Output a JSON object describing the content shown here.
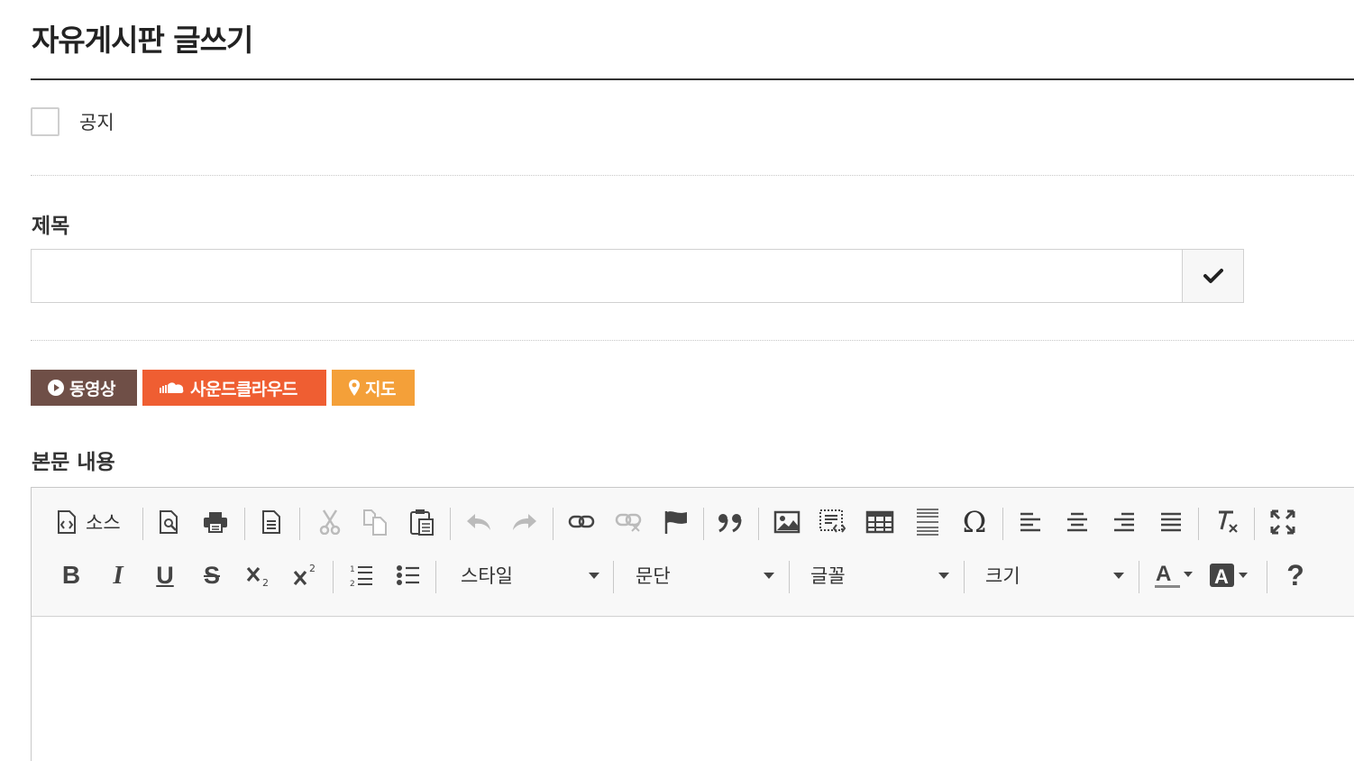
{
  "page": {
    "title": "자유게시판 글쓰기"
  },
  "notice": {
    "label": "공지",
    "checked": false
  },
  "subject": {
    "label": "제목",
    "value": "",
    "placeholder": ""
  },
  "media_buttons": {
    "video": {
      "label": "동영상",
      "icon": "play-circle-icon",
      "color": "#6f4f47"
    },
    "soundcloud": {
      "label": "사운드클라우드",
      "icon": "soundcloud-icon",
      "color": "#ef5e32"
    },
    "map": {
      "label": "지도",
      "icon": "map-marker-icon",
      "color": "#f4a039"
    }
  },
  "body": {
    "label": "본문 내용",
    "content": ""
  },
  "editor_toolbar": {
    "source_label": "소스",
    "style_combo": "스타일",
    "paragraph_combo": "문단",
    "font_combo": "글꼴",
    "size_combo": "크기",
    "row1_icons": [
      "source-icon",
      "preview-icon",
      "print-icon",
      "templates-icon",
      "cut-icon",
      "copy-icon",
      "paste-icon",
      "undo-icon",
      "redo-icon",
      "link-icon",
      "unlink-icon",
      "anchor-icon",
      "blockquote-icon",
      "image-icon",
      "iframe-icon",
      "table-icon",
      "horizontal-rule-icon",
      "special-char-icon",
      "align-left-icon",
      "align-center-icon",
      "align-right-icon",
      "align-justify-icon",
      "remove-format-icon",
      "maximize-icon"
    ],
    "row2_icons": [
      "bold-icon",
      "italic-icon",
      "underline-icon",
      "strike-icon",
      "subscript-icon",
      "superscript-icon",
      "numbered-list-icon",
      "bulleted-list-icon",
      "text-color-icon",
      "bg-color-icon",
      "help-icon"
    ]
  }
}
